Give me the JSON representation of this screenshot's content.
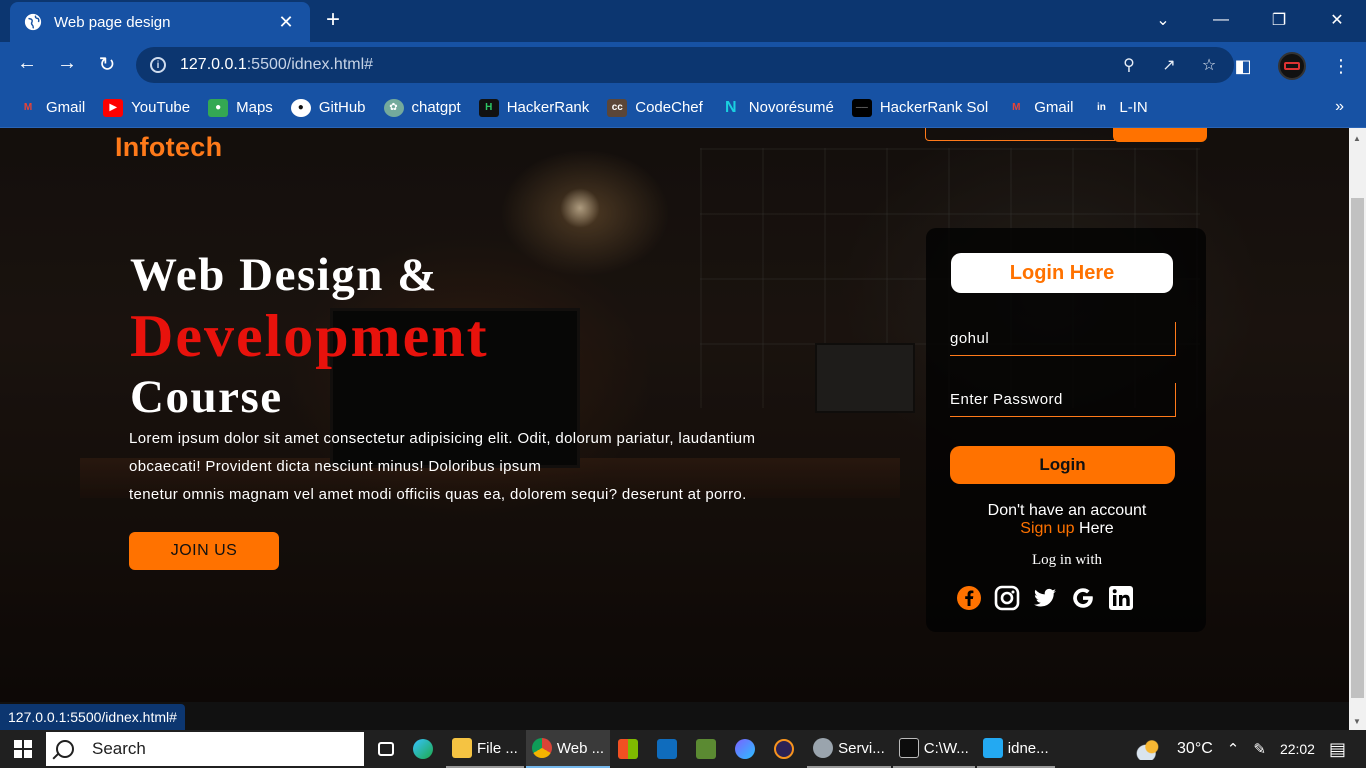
{
  "browser": {
    "tab_title": "Web page design",
    "close_glyph": "✕",
    "new_tab_glyph": "+",
    "url_host": "127.0.0.1",
    "url_rest": ":5500/idnex.html#",
    "status_url": "127.0.0.1:5500/idnex.html#",
    "bookmarks": [
      {
        "label": "Gmail",
        "icon": "gmail-icon",
        "color": "#ea4335"
      },
      {
        "label": "YouTube",
        "icon": "youtube-icon",
        "color": "#ff0000"
      },
      {
        "label": "Maps",
        "icon": "maps-icon",
        "color": "#34a853"
      },
      {
        "label": "GitHub",
        "icon": "github-icon",
        "color": "#ffffff"
      },
      {
        "label": "chatgpt",
        "icon": "chatgpt-icon",
        "color": "#74aa9c"
      },
      {
        "label": "HackerRank",
        "icon": "hackerrank-icon",
        "color": "#111111"
      },
      {
        "label": "CodeChef",
        "icon": "codechef-icon",
        "color": "#5b4638"
      },
      {
        "label": "Novorésumé",
        "icon": "novoresume-icon",
        "color": "#1aa3b8"
      },
      {
        "label": "HackerRank Sol",
        "icon": "hackerrank-sol-icon",
        "color": "#000000"
      },
      {
        "label": "Gmail",
        "icon": "gmail-icon",
        "color": "#ea4335"
      },
      {
        "label": "L-IN",
        "icon": "linkedin-icon",
        "color": "#0a66c2"
      }
    ],
    "more_glyph": "»"
  },
  "page": {
    "logo": "Infotech",
    "hero": {
      "line1": "Web Design &",
      "line2": "Development",
      "line3": "Course",
      "para_line1": "Lorem ipsum dolor sit amet consectetur adipisicing elit. Odit, dolorum pariatur, laudantium",
      "para_line2": "obcaecati! Provident dicta nesciunt minus! Doloribus ipsum",
      "para_line3": "tenetur omnis magnam vel amet modi officiis quas ea, dolorem sequi? deserunt at porro.",
      "join_label": "JOIN US"
    },
    "login": {
      "title": "Login Here",
      "username_value": "gohul",
      "password_placeholder": "Enter Password",
      "button_label": "Login",
      "no_account": "Don't have an account",
      "signup_link": "Sign up",
      "signup_tail": " Here",
      "login_with": "Log in with",
      "socials": [
        "facebook-icon",
        "instagram-icon",
        "twitter-icon",
        "google-icon",
        "linkedin-icon"
      ]
    },
    "accent_color": "#ff7200",
    "highlight_color": "#e8120c"
  },
  "taskbar": {
    "search_label": "Search",
    "items": [
      {
        "label": "",
        "icon": "task-view-icon"
      },
      {
        "label": "",
        "icon": "edge-icon"
      },
      {
        "label": "File ...",
        "icon": "file-explorer-icon"
      },
      {
        "label": "Web ...",
        "icon": "chrome-icon"
      },
      {
        "label": "",
        "icon": "store-icon"
      },
      {
        "label": "",
        "icon": "mail-icon"
      },
      {
        "label": "",
        "icon": "minecraft-icon"
      },
      {
        "label": "",
        "icon": "copilot-icon"
      },
      {
        "label": "",
        "icon": "eclipse-icon"
      },
      {
        "label": "Servi...",
        "icon": "services-icon"
      },
      {
        "label": "C:\\W...",
        "icon": "terminal-icon"
      },
      {
        "label": "idne...",
        "icon": "vscode-icon"
      }
    ],
    "weather": "30°C",
    "time": "22:02"
  }
}
